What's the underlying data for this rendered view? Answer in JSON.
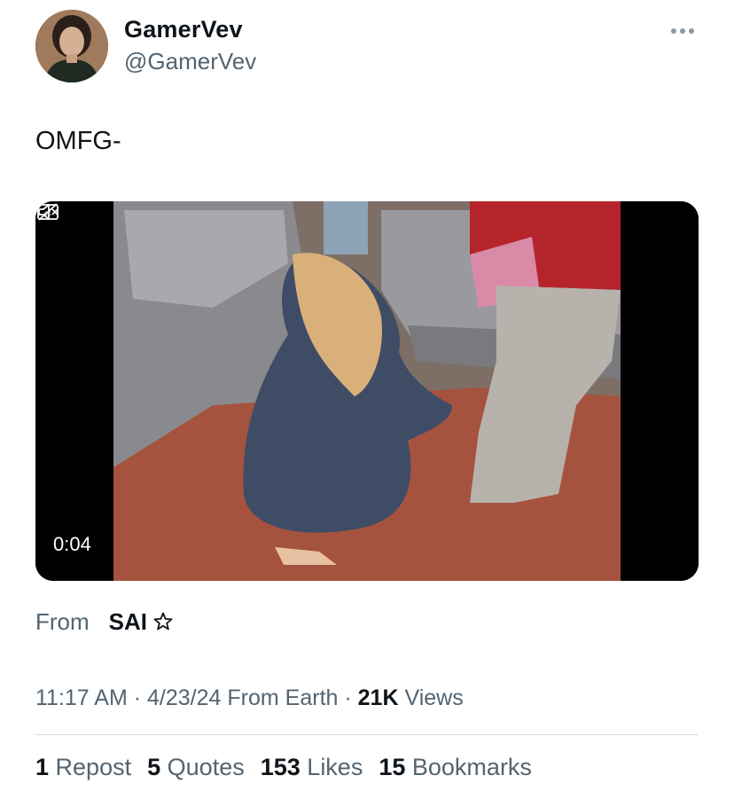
{
  "author": {
    "display_name": "GamerVev",
    "handle": "@GamerVev",
    "avatar_icon": "profile-avatar"
  },
  "more_icon": "ellipsis-icon",
  "tweet": {
    "text": "OMFG-"
  },
  "video": {
    "duration": "0:04",
    "captions_icon": "captions-off-icon",
    "mute_icon": "speaker-muted-icon"
  },
  "source": {
    "from_label": "From",
    "name": "SAI",
    "badge_icon": "star-outline-icon"
  },
  "meta": {
    "time": "11:17 AM",
    "date": "4/23/24",
    "location": "From Earth",
    "sep": "·",
    "views_count": "21K",
    "views_label": "Views"
  },
  "stats": {
    "reposts_count": "1",
    "reposts_label": "Repost",
    "quotes_count": "5",
    "quotes_label": "Quotes",
    "likes_count": "153",
    "likes_label": "Likes",
    "bookmarks_count": "15",
    "bookmarks_label": "Bookmarks"
  },
  "colors": {
    "text_primary": "#0f1419",
    "text_secondary": "#536471",
    "divider": "#cfd9de"
  }
}
